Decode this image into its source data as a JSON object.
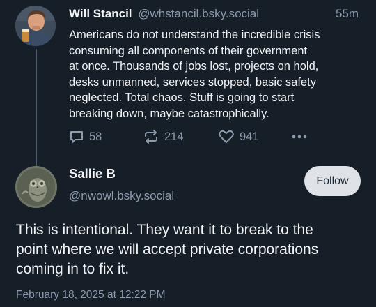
{
  "parent_post": {
    "author_name": "Will Stancil",
    "author_handle": "@whstancil.bsky.social",
    "time_ago": "55m",
    "text_lines": [
      "Americans do not understand the incredible crisis",
      "consuming all components of their government",
      "at once. Thousands of jobs lost, projects on hold,",
      "desks unmanned, services stopped, basic safety",
      "neglected. Total chaos. Stuff is going to start",
      "breaking down, maybe catastrophically."
    ],
    "actions": {
      "reply_count": "58",
      "repost_count": "214",
      "like_count": "941",
      "reply_icon": "comment-icon",
      "repost_icon": "repost-icon",
      "like_icon": "heart-icon",
      "more_icon": "more-icon"
    }
  },
  "reply_post": {
    "author_name": "Sallie B",
    "author_handle": "@nwowl.bsky.social",
    "follow_label": "Follow",
    "text_lines": [
      "This is intentional. They want it to break to the",
      "point where we will accept private corporations",
      "coming in to fix it."
    ],
    "timestamp": "February 18, 2025 at 12:22 PM"
  },
  "colors": {
    "background": "#161e27",
    "text_primary": "#f1f3f5",
    "text_secondary": "#8b9bad",
    "follow_button_bg": "#dfe3e8"
  }
}
